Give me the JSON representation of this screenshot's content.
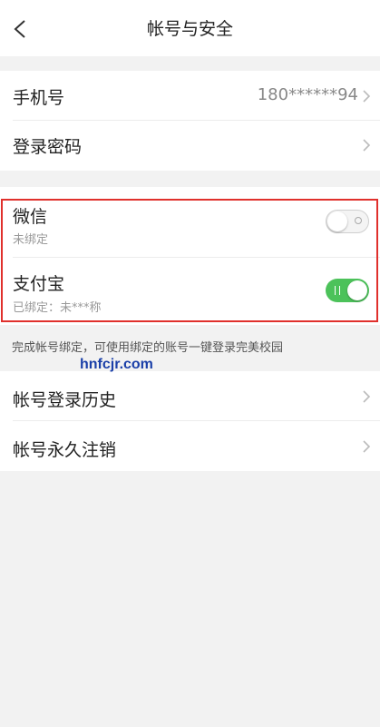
{
  "header": {
    "title": "帐号与安全",
    "back_icon": "chevron-left-icon"
  },
  "account": {
    "phone": {
      "label": "手机号",
      "value": "180******94"
    },
    "password": {
      "label": "登录密码"
    }
  },
  "bindings": {
    "wechat": {
      "label": "微信",
      "status": "未绑定",
      "enabled": false
    },
    "alipay": {
      "label": "支付宝",
      "status": "已绑定：未***称",
      "enabled": true
    },
    "note": "完成帐号绑定，可使用绑定的账号一键登录完美校园"
  },
  "watermark": "hnfcjr.com",
  "more": {
    "login_history": {
      "label": "帐号登录历史"
    },
    "deactivate": {
      "label": "帐号永久注销"
    }
  },
  "colors": {
    "toggle_on": "#4cc25a",
    "highlight_border": "#e0302c",
    "watermark": "#1a3fa8"
  }
}
